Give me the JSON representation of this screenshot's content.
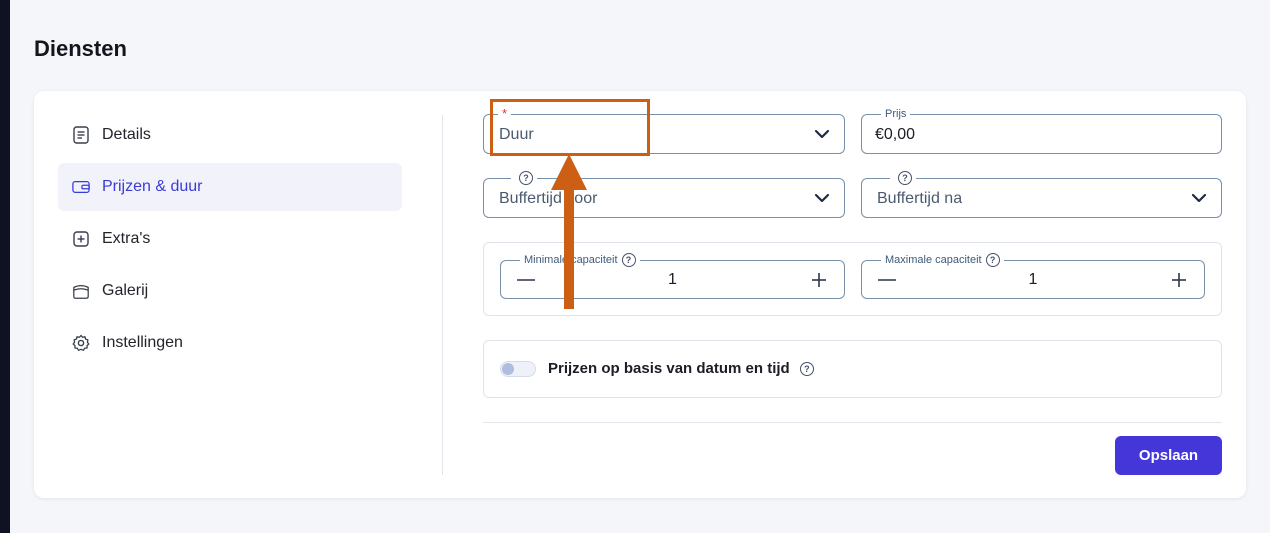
{
  "page": {
    "title": "Diensten"
  },
  "sidebar": {
    "items": [
      {
        "label": "Details",
        "icon": "document-icon",
        "active": false
      },
      {
        "label": "Prijzen & duur",
        "icon": "wallet-icon",
        "active": true
      },
      {
        "label": "Extra's",
        "icon": "plus-square-icon",
        "active": false
      },
      {
        "label": "Galerij",
        "icon": "gallery-icon",
        "active": false
      },
      {
        "label": "Instellingen",
        "icon": "gear-icon",
        "active": false
      }
    ]
  },
  "form": {
    "duur": {
      "required_mark": "*",
      "placeholder": "Duur"
    },
    "prijs": {
      "label": "Prijs",
      "value": "€0,00"
    },
    "buffer_voor": {
      "placeholder": "Buffertijd voor"
    },
    "buffer_na": {
      "placeholder": "Buffertijd na"
    },
    "min_capacity": {
      "label": "Minimale capaciteit",
      "value": "1"
    },
    "max_capacity": {
      "label": "Maximale capaciteit",
      "value": "1"
    },
    "date_time_pricing": {
      "label": "Prijzen op basis van datum en tijd",
      "enabled": false
    },
    "save_label": "Opslaan"
  },
  "colors": {
    "accent": "#4436d9",
    "active_nav_text": "#3b3bd6",
    "annotation": "#cc5f14"
  }
}
